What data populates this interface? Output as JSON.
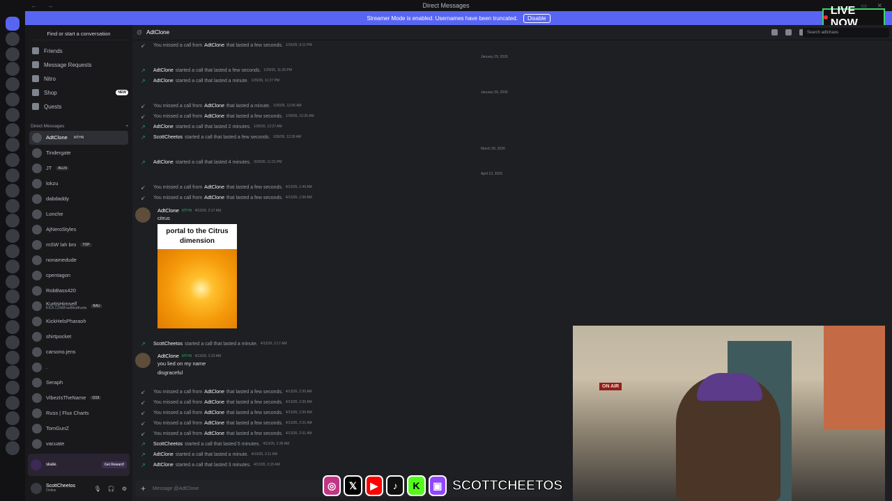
{
  "window": {
    "title": "Direct Messages"
  },
  "streamer_banner": {
    "text": "Streamer Mode is enabled. Usernames have been truncated.",
    "button": "Disable"
  },
  "overlay": {
    "live_label": "LIVE NOW",
    "channel": "SCOTTCHEETOS",
    "social_icons": [
      "instagram-icon",
      "x-icon",
      "youtube-icon",
      "tiktok-icon",
      "kick-icon",
      "twitch-icon"
    ]
  },
  "sidebar": {
    "search": "Find or start a conversation",
    "nav": [
      {
        "label": "Friends",
        "icon": "friends-icon"
      },
      {
        "label": "Message Requests",
        "icon": "mail-icon"
      },
      {
        "label": "Nitro",
        "icon": "nitro-icon"
      },
      {
        "label": "Shop",
        "icon": "shop-icon",
        "badge": "NEW"
      },
      {
        "label": "Quests",
        "icon": "quests-icon"
      }
    ],
    "dm_header": "Direct Messages",
    "dms": [
      {
        "name": "AdtClone",
        "tag": "MTHN"
      },
      {
        "name": "Tindergate"
      },
      {
        "name": "JT",
        "tag": "ALLN"
      },
      {
        "name": "lokzu"
      },
      {
        "name": "dabdaddy"
      },
      {
        "name": "Lonche"
      },
      {
        "name": "AjNeroStyles"
      },
      {
        "name": "mSW lah bro",
        "tag": "TOP"
      },
      {
        "name": "nonamedude"
      },
      {
        "name": "cpentagon"
      },
      {
        "name": "RobBass420"
      },
      {
        "name": "KurtisHimself",
        "tag": "BAU",
        "sub": "KICK.COM/FastModKurtis"
      },
      {
        "name": "KickHelsPharaoh"
      },
      {
        "name": "shirtpocket"
      },
      {
        "name": "carsono.jens"
      },
      {
        "name": "."
      },
      {
        "name": "Seraph"
      },
      {
        "name": "VibezIsTheName",
        "tag": "GS9"
      },
      {
        "name": "Russ | Flux Charts"
      },
      {
        "name": "TomGunZ"
      },
      {
        "name": "vacuate"
      }
    ],
    "promo": {
      "brand": "skate.",
      "button": "Get Reward!"
    },
    "user": {
      "name": "ScottCheetos",
      "status": "Online"
    }
  },
  "channel": {
    "name": "AdtClone",
    "search_placeholder": "Search adtchaos",
    "composer_placeholder": "Message @AdtClone"
  },
  "dates": [
    "January 29, 2026",
    "January 30, 2026",
    "March 29, 2026",
    "April 13, 2026"
  ],
  "calls": [
    {
      "type": "missed",
      "pre": "You missed a call from",
      "name": "AdtClone",
      "post": "that lasted a few seconds.",
      "ts": "1/16/26, 9:11 PM"
    },
    {
      "type": "out",
      "pre": "",
      "name": "AdtClone",
      "post": "started a call that lasted a few seconds.",
      "ts": "1/29/26, 11:26 PM"
    },
    {
      "type": "out",
      "pre": "",
      "name": "AdtClone",
      "post": "started a call that lasted a minute.",
      "ts": "1/29/26, 11:27 PM"
    },
    {
      "type": "missed",
      "pre": "You missed a call from",
      "name": "AdtClone",
      "post": "that lasted a minute.",
      "ts": "1/30/26, 12:06 AM"
    },
    {
      "type": "missed",
      "pre": "You missed a call from",
      "name": "AdtClone",
      "post": "that lasted a few seconds.",
      "ts": "1/30/26, 12:26 AM"
    },
    {
      "type": "out",
      "pre": "",
      "name": "AdtClone",
      "post": "started a call that lasted 2 minutes.",
      "ts": "1/30/26, 12:27 AM"
    },
    {
      "type": "out",
      "pre": "",
      "name": "ScottCheetos",
      "post": "started a call that lasted a few seconds.",
      "ts": "1/30/26, 12:30 AM"
    },
    {
      "type": "out",
      "pre": "",
      "name": "AdtClone",
      "post": "started a call that lasted 4 minutes.",
      "ts": "3/29/26, 11:31 PM"
    },
    {
      "type": "missed",
      "pre": "You missed a call from",
      "name": "AdtClone",
      "post": "that lasted a few seconds.",
      "ts": "4/13/26, 1:49 AM"
    },
    {
      "type": "missed",
      "pre": "You missed a call from",
      "name": "AdtClone",
      "post": "that lasted a few seconds.",
      "ts": "4/13/26, 1:56 AM"
    },
    {
      "type": "out",
      "pre": "",
      "name": "ScottCheetos",
      "post": "started a call that lasted a minute.",
      "ts": "4/13/26, 2:17 AM"
    },
    {
      "type": "missed",
      "pre": "You missed a call from",
      "name": "AdtClone",
      "post": "that lasted a few seconds.",
      "ts": "4/13/26, 2:30 AM"
    },
    {
      "type": "missed",
      "pre": "You missed a call from",
      "name": "AdtClone",
      "post": "that lasted a few seconds.",
      "ts": "4/13/26, 2:30 AM"
    },
    {
      "type": "missed",
      "pre": "You missed a call from",
      "name": "AdtClone",
      "post": "that lasted a few seconds.",
      "ts": "4/13/26, 2:30 AM"
    },
    {
      "type": "missed",
      "pre": "You missed a call from",
      "name": "AdtClone",
      "post": "that lasted a few seconds.",
      "ts": "4/13/26, 2:31 AM"
    },
    {
      "type": "missed",
      "pre": "You missed a call from",
      "name": "AdtClone",
      "post": "that lasted a few seconds.",
      "ts": "4/13/26, 2:31 AM"
    },
    {
      "type": "out",
      "pre": "",
      "name": "ScottCheetos",
      "post": "started a call that lasted 5 minutes.",
      "ts": "4/13/26, 2:36 AM"
    },
    {
      "type": "out",
      "pre": "",
      "name": "AdtClone",
      "post": "started a call that lasted a minute.",
      "ts": "4/13/26, 3:11 AM"
    },
    {
      "type": "out",
      "pre": "",
      "name": "AdtClone",
      "post": "started a call that lasted 3 minutes.",
      "ts": "4/13/26, 3:15 AM"
    }
  ],
  "messages": [
    {
      "author": "AdtClone",
      "tag": "MTHN",
      "ts": "4/13/26, 2:17 AM",
      "lines": [
        "citrus"
      ],
      "image_caption": "portal to the Citrus dimension"
    },
    {
      "author": "AdtClone",
      "tag": "MTHN",
      "ts": "4/13/26, 2:23 AM",
      "lines": [
        "you lied on my name",
        "disgraceful"
      ]
    }
  ],
  "webcam": {
    "sign": "ON AIR"
  }
}
